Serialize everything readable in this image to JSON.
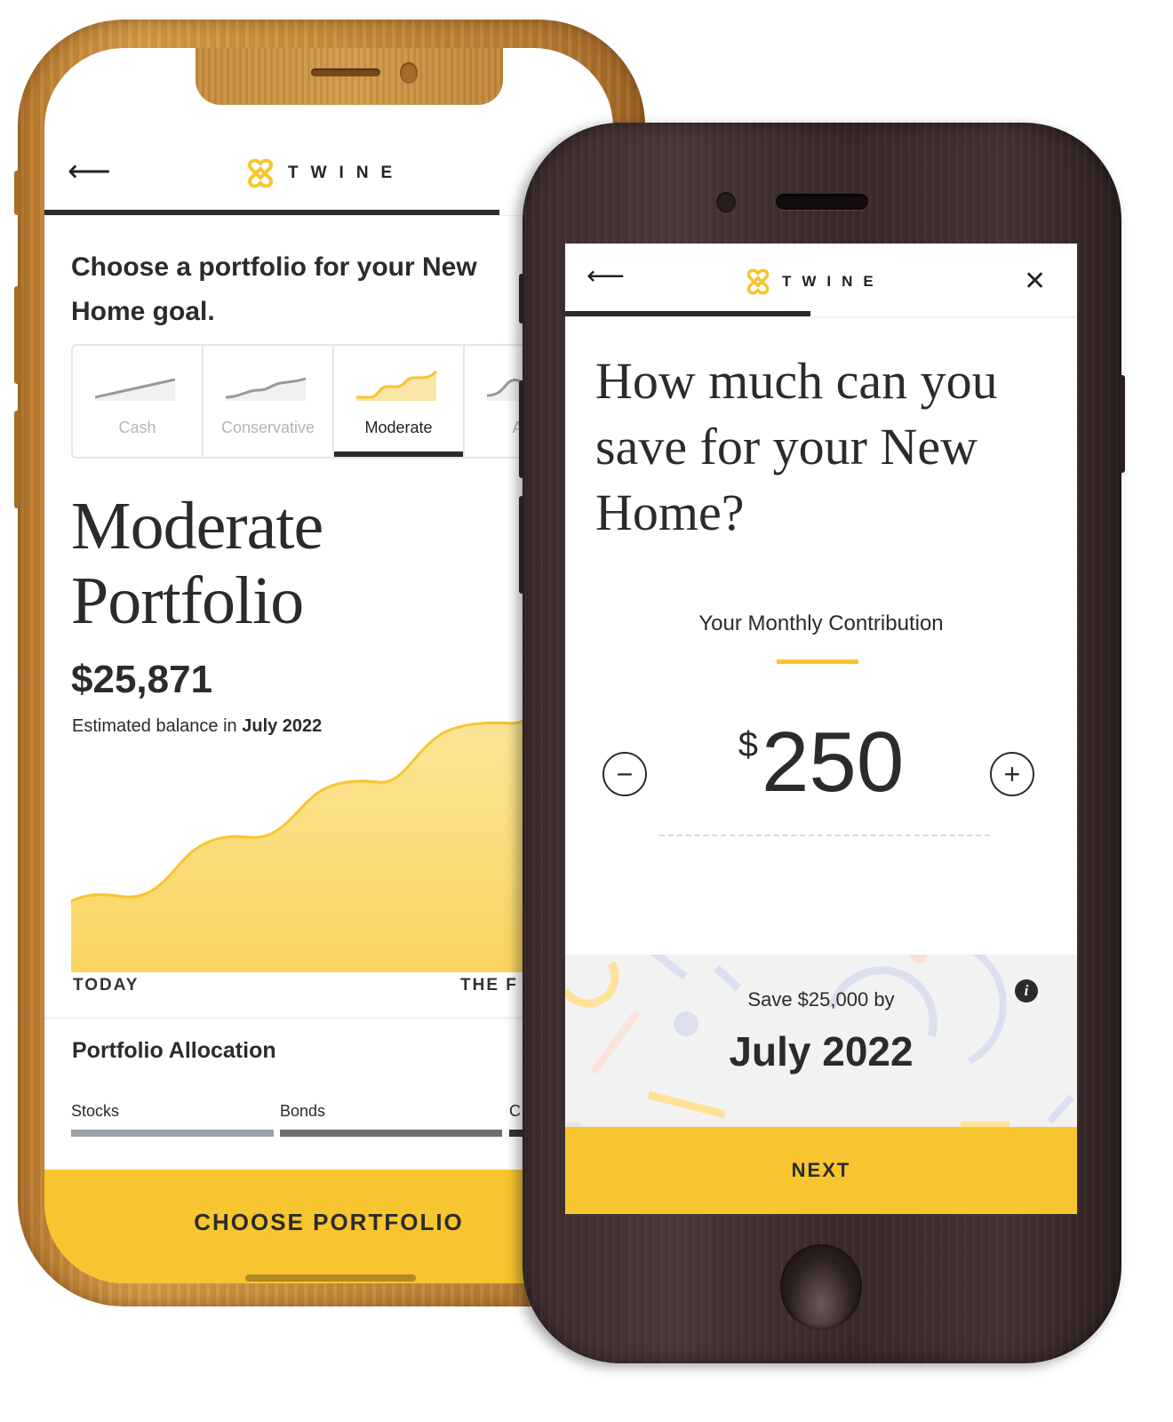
{
  "brand": {
    "name": "TWINE",
    "accent_color": "#f7c52f",
    "logo_icon": "twine-knot-icon"
  },
  "left_phone": {
    "header": {
      "back_icon": "arrow-left-icon",
      "back_glyph": "⟵",
      "progress_fraction": 0.8
    },
    "title": "Choose a portfolio for your New Home goal.",
    "portfolio_tabs": [
      {
        "label": "Cash",
        "active": false
      },
      {
        "label": "Conservative",
        "active": false
      },
      {
        "label": "Moderate",
        "active": true
      },
      {
        "label": "Aggressive",
        "active": false,
        "visible_label": "Aggr"
      }
    ],
    "portfolio_name_line1": "Moderate",
    "portfolio_name_line2": "Portfolio",
    "balance": "$25,871",
    "estimate_prefix": "Estimated balance in ",
    "estimate_date": "July 2022",
    "chart": {
      "start_label": "TODAY",
      "end_label": "THE F"
    },
    "allocation": {
      "title": "Portfolio Allocation",
      "items": [
        {
          "label": "Stocks",
          "color": "#9aa2a6"
        },
        {
          "label": "Bonds",
          "color": "#6b7073"
        },
        {
          "label": "C",
          "color": "#333333"
        }
      ]
    },
    "cta_label": "CHOOSE PORTFOLIO"
  },
  "right_phone": {
    "header": {
      "back_icon": "arrow-left-icon",
      "back_glyph": "⟵",
      "close_icon": "close-icon",
      "close_glyph": "✕",
      "progress_fraction": 0.48
    },
    "question": "How much can you save for your New Home?",
    "contribution_label": "Your Monthly Contribution",
    "currency_symbol": "$",
    "amount": "250",
    "decrement_glyph": "−",
    "increment_glyph": "+",
    "goal_text": "Save $25,000 by",
    "goal_date": "July 2022",
    "info_glyph": "i",
    "cta_label": "NEXT"
  }
}
